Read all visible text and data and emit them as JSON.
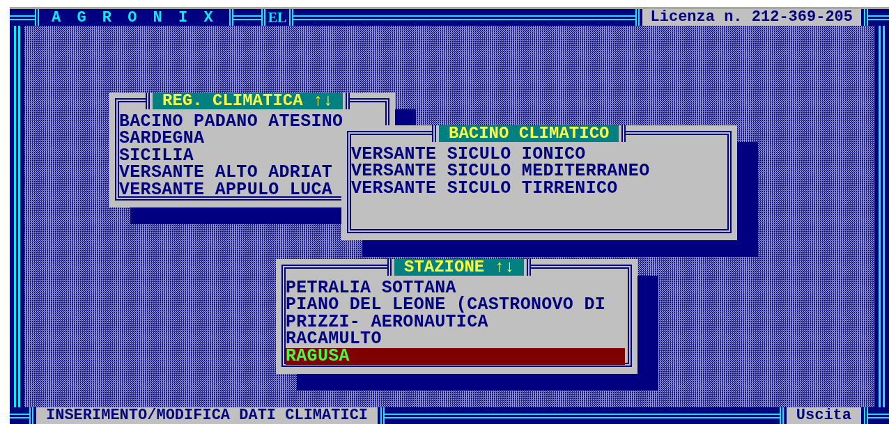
{
  "header": {
    "title": "A G R O N I X",
    "mode": "EL",
    "license": "Licenza n. 212-369-205"
  },
  "windows": [
    {
      "title": "REG. CLIMATICA ↑↓",
      "items": [
        {
          "label": "BACINO PADANO ATESINO",
          "selected": false
        },
        {
          "label": "SARDEGNA",
          "selected": false
        },
        {
          "label": "SICILIA",
          "selected": false
        },
        {
          "label": "VERSANTE ALTO ADRIAT",
          "selected": false
        },
        {
          "label": "VERSANTE APPULO LUCA",
          "selected": false
        }
      ]
    },
    {
      "title": "BACINO CLIMATICO",
      "items": [
        {
          "label": "VERSANTE SICULO IONICO",
          "selected": false
        },
        {
          "label": "VERSANTE SICULO MEDITERRANEO",
          "selected": false
        },
        {
          "label": "VERSANTE SICULO TIRRENICO",
          "selected": false
        }
      ]
    },
    {
      "title": "STAZIONE ↑↓",
      "items": [
        {
          "label": "PETRALIA SOTTANA",
          "selected": false
        },
        {
          "label": "PIANO DEL LEONE (CASTRONOVO DI",
          "selected": false
        },
        {
          "label": "PRIZZI- AERONAUTICA",
          "selected": false
        },
        {
          "label": "RACAMULTO",
          "selected": false
        },
        {
          "label": "RAGUSA",
          "selected": true
        }
      ]
    }
  ],
  "status_bar": {
    "message": "INSERIMENTO/MODIFICA DATI CLIMATICI",
    "exit": "Uscita"
  }
}
